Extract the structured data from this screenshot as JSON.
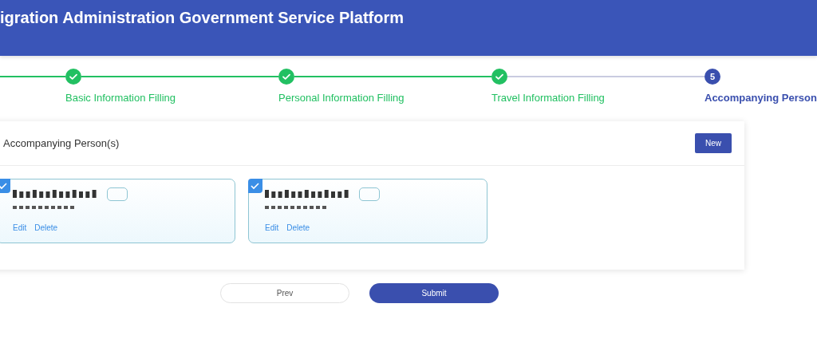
{
  "header": {
    "title": "igration Administration Government Service Platform"
  },
  "steps": [
    {
      "label": "Basic Information Filling",
      "completed": true
    },
    {
      "label": "Personal Information Filling",
      "completed": true
    },
    {
      "label": "Travel Information Filling",
      "completed": true
    },
    {
      "label": "Accompanying Person",
      "completed": false,
      "number": "5"
    }
  ],
  "panel": {
    "title": "Accompanying Person(s)",
    "new_button": "New"
  },
  "persons": [
    {
      "selected": true,
      "actions": [
        "Edit",
        "Delete"
      ]
    },
    {
      "selected": true,
      "actions": [
        "Edit",
        "Delete"
      ]
    }
  ],
  "footer": {
    "prev": "Prev",
    "submit": "Submit"
  }
}
